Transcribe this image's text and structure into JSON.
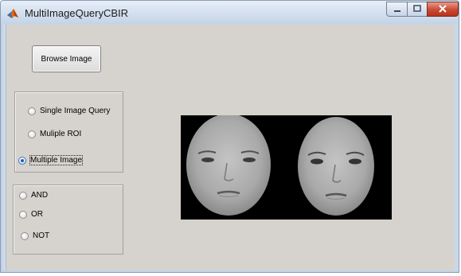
{
  "window": {
    "title": "MultiImageQueryCBIR",
    "icon": "matlab-icon",
    "controls": [
      "minimize-icon",
      "maximize-icon",
      "close-icon"
    ],
    "accent_colors": {
      "close": "#c94a33",
      "titlebar": "#c3d3e6",
      "client": "#d6d3ce"
    }
  },
  "toolbar": {
    "browse_label": "Browse Image"
  },
  "query_panel": {
    "options": [
      {
        "label": "Single Image Query",
        "checked": false
      },
      {
        "label": "Muliple ROI",
        "checked": false
      },
      {
        "label": "Multiple Image",
        "checked": true
      }
    ]
  },
  "logic_panel": {
    "options": [
      {
        "label": "AND",
        "checked": false
      },
      {
        "label": "OR",
        "checked": false
      },
      {
        "label": "NOT",
        "checked": false
      }
    ]
  },
  "preview": {
    "content": "two grayscale face images on black background"
  }
}
